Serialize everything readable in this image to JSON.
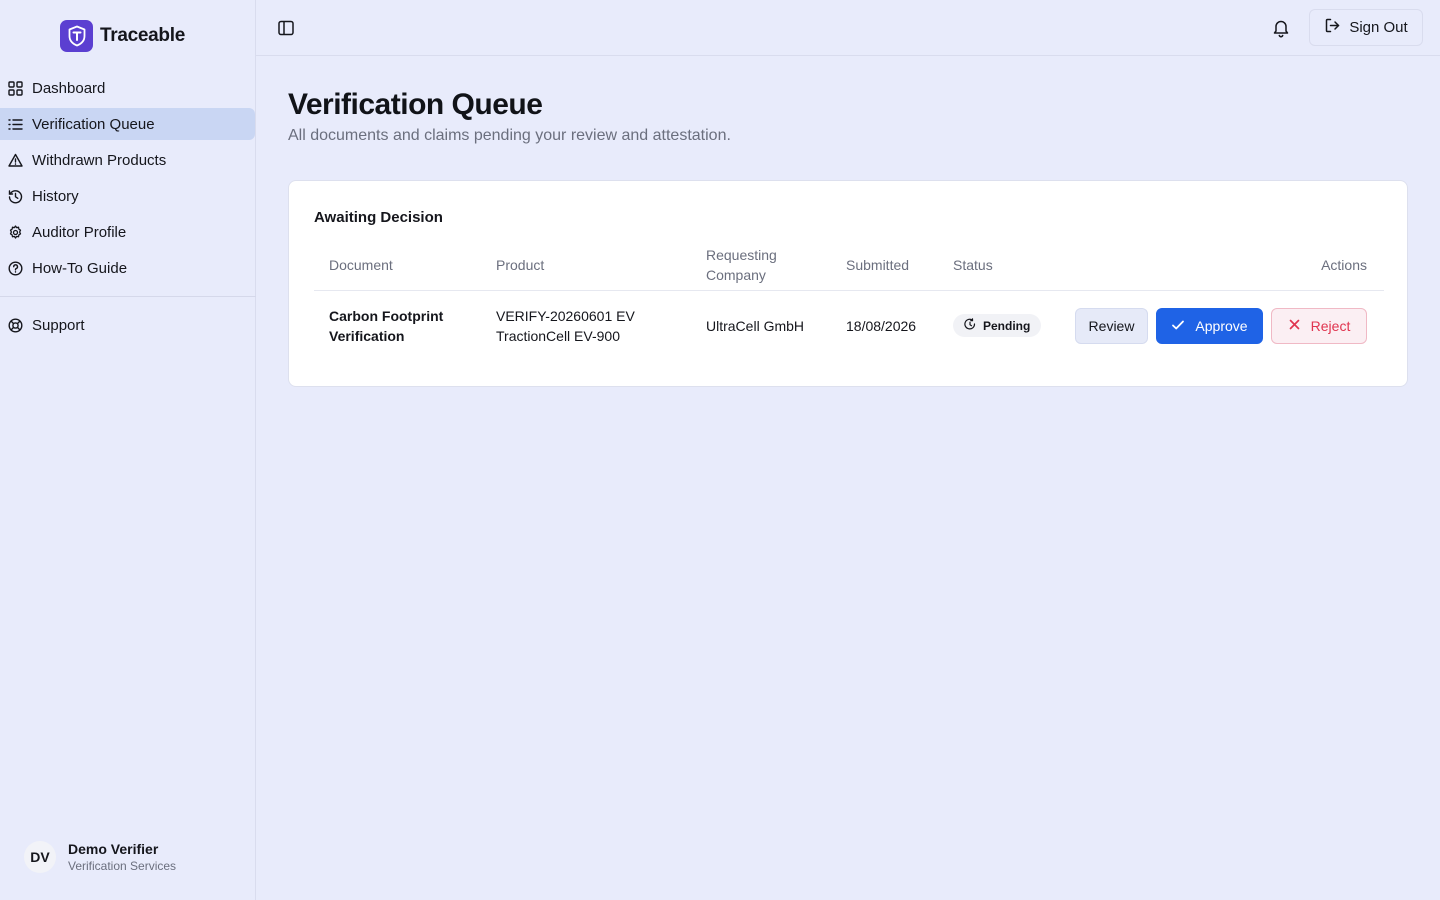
{
  "app": {
    "name": "Traceable"
  },
  "sidebar": {
    "items": [
      {
        "label": "Dashboard",
        "icon": "grid-icon",
        "active": false
      },
      {
        "label": "Verification Queue",
        "icon": "list-icon",
        "active": true
      },
      {
        "label": "Withdrawn Products",
        "icon": "warning-triangle-icon",
        "active": false
      },
      {
        "label": "History",
        "icon": "history-icon",
        "active": false
      },
      {
        "label": "Auditor Profile",
        "icon": "gear-icon",
        "active": false
      },
      {
        "label": "How-To Guide",
        "icon": "help-circle-icon",
        "active": false
      }
    ],
    "support": {
      "label": "Support",
      "icon": "lifebuoy-icon"
    },
    "user": {
      "initials": "DV",
      "name": "Demo Verifier",
      "organization": "Verification Services"
    }
  },
  "topbar": {
    "toggle_icon": "sidebar-toggle-icon",
    "bell_icon": "bell-icon",
    "sign_out_label": "Sign Out"
  },
  "page": {
    "title": "Verification Queue",
    "subtitle": "All documents and claims pending your review and attestation."
  },
  "card": {
    "title": "Awaiting Decision",
    "columns": [
      "Document",
      "Product",
      "Requesting Company",
      "Submitted",
      "Status",
      "Actions"
    ],
    "rows": [
      {
        "document": "Carbon Footprint Verification",
        "product": "VERIFY-20260601 EV TractionCell EV-900",
        "company": "UltraCell GmbH",
        "submitted": "18/08/2026",
        "status": "Pending",
        "actions": {
          "review": "Review",
          "approve": "Approve",
          "reject": "Reject"
        }
      }
    ]
  },
  "colors": {
    "accent": "#1f63e6",
    "brand": "#5b3fd1",
    "danger": "#e0344f",
    "active_nav": "#c9d6f3",
    "background": "#e8ebfb"
  }
}
